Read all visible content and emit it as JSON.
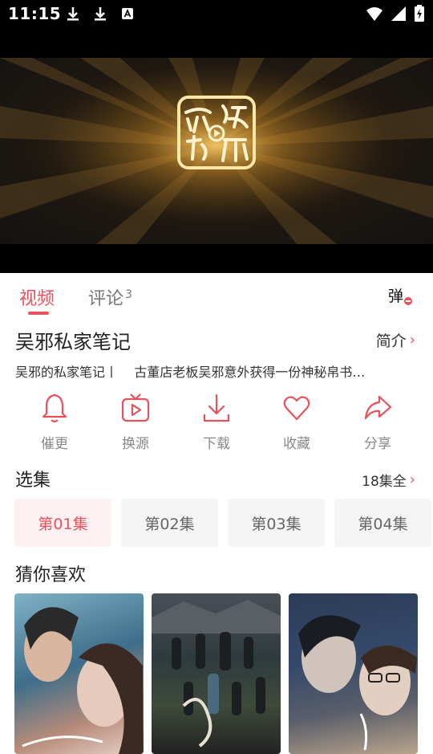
{
  "status": {
    "time": "11:15"
  },
  "tabs": [
    {
      "label": "视频"
    },
    {
      "label": "评论",
      "count": "3"
    }
  ],
  "danmaku": {
    "label": "弹"
  },
  "show": {
    "title": "吴邪私家笔记",
    "intro_label": "简介",
    "description": "吴邪的私家笔记丨    古董店老板吴邪意外获得一份神秘帛书…"
  },
  "actions": [
    {
      "label": "催更",
      "icon": "bell-icon"
    },
    {
      "label": "换源",
      "icon": "tv-icon"
    },
    {
      "label": "下载",
      "icon": "download-icon"
    },
    {
      "label": "收藏",
      "icon": "heart-icon"
    },
    {
      "label": "分享",
      "icon": "share-icon"
    }
  ],
  "episodes": {
    "title": "选集",
    "all_label": "18集全",
    "items": [
      {
        "label": "第01集",
        "active": true
      },
      {
        "label": "第02集",
        "active": false
      },
      {
        "label": "第03集",
        "active": false
      },
      {
        "label": "第04集",
        "active": false
      }
    ]
  },
  "recommend": {
    "title": "猜你喜欢"
  },
  "colors": {
    "accent": "#e8525e",
    "tile_bg": "#f5f5f5",
    "active_tile_bg": "#fdf1f1"
  }
}
